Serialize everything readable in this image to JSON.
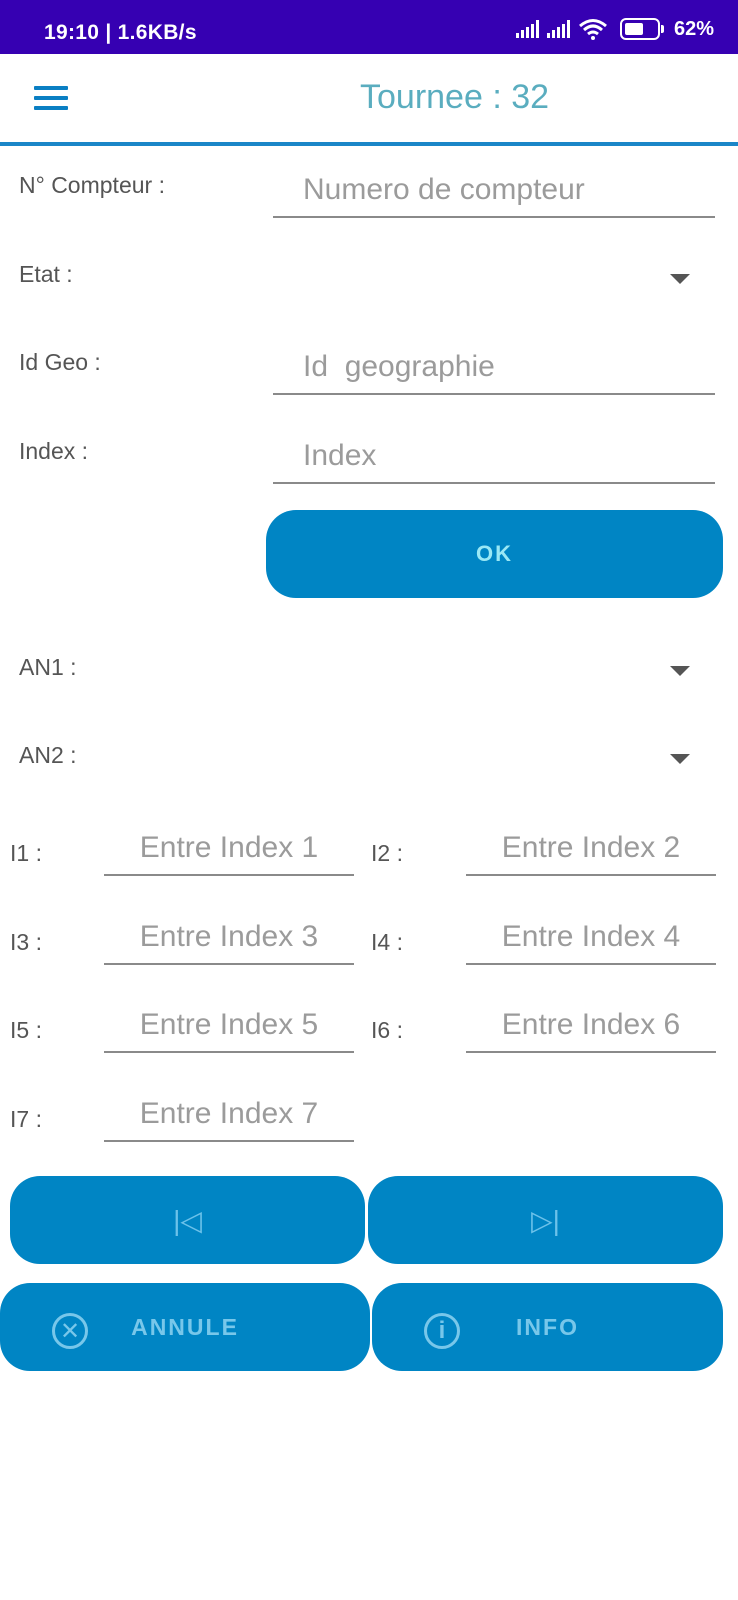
{
  "status_bar": {
    "time_speed": "19:10 | 1.6KB/s",
    "battery_level": 0.62,
    "battery_label": "62%"
  },
  "app_bar": {
    "menu_icon": "hamburger-menu-icon",
    "title": "Tournee : 32"
  },
  "form": {
    "compteur": {
      "label": "N° Compteur :",
      "placeholder": "Numero de compteur",
      "value": ""
    },
    "etat": {
      "label": "Etat :",
      "value": ""
    },
    "id_geo": {
      "label": "Id Geo :",
      "placeholder": "Id  geographie",
      "value": ""
    },
    "index": {
      "label": "Index :",
      "placeholder": "Index",
      "value": ""
    },
    "ok_label": "OK",
    "an1": {
      "label": "AN1 :",
      "value": ""
    },
    "an2": {
      "label": "AN2 :",
      "value": ""
    },
    "indexes": [
      {
        "label": "I1 :",
        "placeholder": "Entre Index 1"
      },
      {
        "label": "I2 :",
        "placeholder": "Entre Index 2"
      },
      {
        "label": "I3 :",
        "placeholder": "Entre Index 3"
      },
      {
        "label": "I4 :",
        "placeholder": "Entre Index 4"
      },
      {
        "label": "I5 :",
        "placeholder": "Entre Index 5"
      },
      {
        "label": "I6 :",
        "placeholder": "Entre Index 6"
      },
      {
        "label": "I7 :",
        "placeholder": "Entre Index 7"
      }
    ]
  },
  "nav": {
    "first_icon": "skip-previous-icon",
    "last_icon": "skip-next-icon",
    "first_glyph": "|◁",
    "last_glyph": "▷|"
  },
  "actions": {
    "cancel_label": "ANNULE",
    "cancel_icon": "cancel-circle-icon",
    "cancel_glyph": "✕",
    "info_label": "INFO",
    "info_icon": "info-circle-icon",
    "info_glyph": "i"
  },
  "colors": {
    "status_bar": "#3600b2",
    "primary": "#0085c4",
    "title": "#5aadbf",
    "divider": "#1a86c8"
  }
}
